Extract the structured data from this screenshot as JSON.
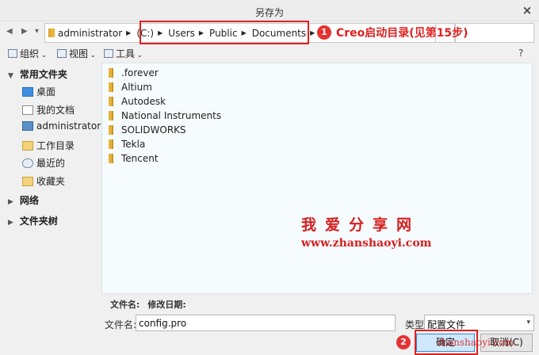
{
  "window": {
    "title": "另存为",
    "close_glyph": "×"
  },
  "nav": {
    "back_glyph": "◀",
    "forward_glyph": "▶",
    "dropdown_glyph": "▾",
    "path": [
      "administrator",
      "(C:)",
      "Users",
      "Public",
      "Documents"
    ],
    "separator_glyph": "▶"
  },
  "annotations": {
    "step1_number": "1",
    "step1_text": "Creo启动目录(见第15步)",
    "step2_number": "2",
    "color": "#e02020"
  },
  "toolbar": {
    "organize": "组织",
    "view": "视图",
    "tools": "工具",
    "caret_glyph": "⌄",
    "help_glyph": "?"
  },
  "sidebar": {
    "favorites_label": "常用文件夹",
    "items": [
      {
        "label": "桌面",
        "icon": "desktop-icon"
      },
      {
        "label": "我的文档",
        "icon": "documents-icon"
      },
      {
        "label": "administrator",
        "icon": "computer-icon"
      },
      {
        "label": "工作目录",
        "icon": "working-dir-icon"
      },
      {
        "label": "最近的",
        "icon": "recent-icon"
      },
      {
        "label": "收藏夹",
        "icon": "favorites-icon"
      }
    ],
    "network_label": "网络",
    "folder_tree_label": "文件夹树",
    "expanded_glyph": "▼",
    "collapsed_glyph": "▶"
  },
  "files": [
    ".forever",
    "Altium",
    "Autodesk",
    "National Instruments",
    "SOLIDWORKS",
    "Tekla",
    "Tencent"
  ],
  "watermark": {
    "title": "我爱分享网",
    "url": "www.zhanshaoyi.com",
    "url_overlay": "zhanshaoyi.com"
  },
  "details": {
    "filename_header": "文件名:",
    "modified_header": "修改日期:"
  },
  "form": {
    "filename_label": "文件名:",
    "filename_value": "config.pro",
    "type_label": "类型",
    "type_value": "配置文件"
  },
  "buttons": {
    "ok": "确定",
    "cancel": "取消(C)"
  }
}
